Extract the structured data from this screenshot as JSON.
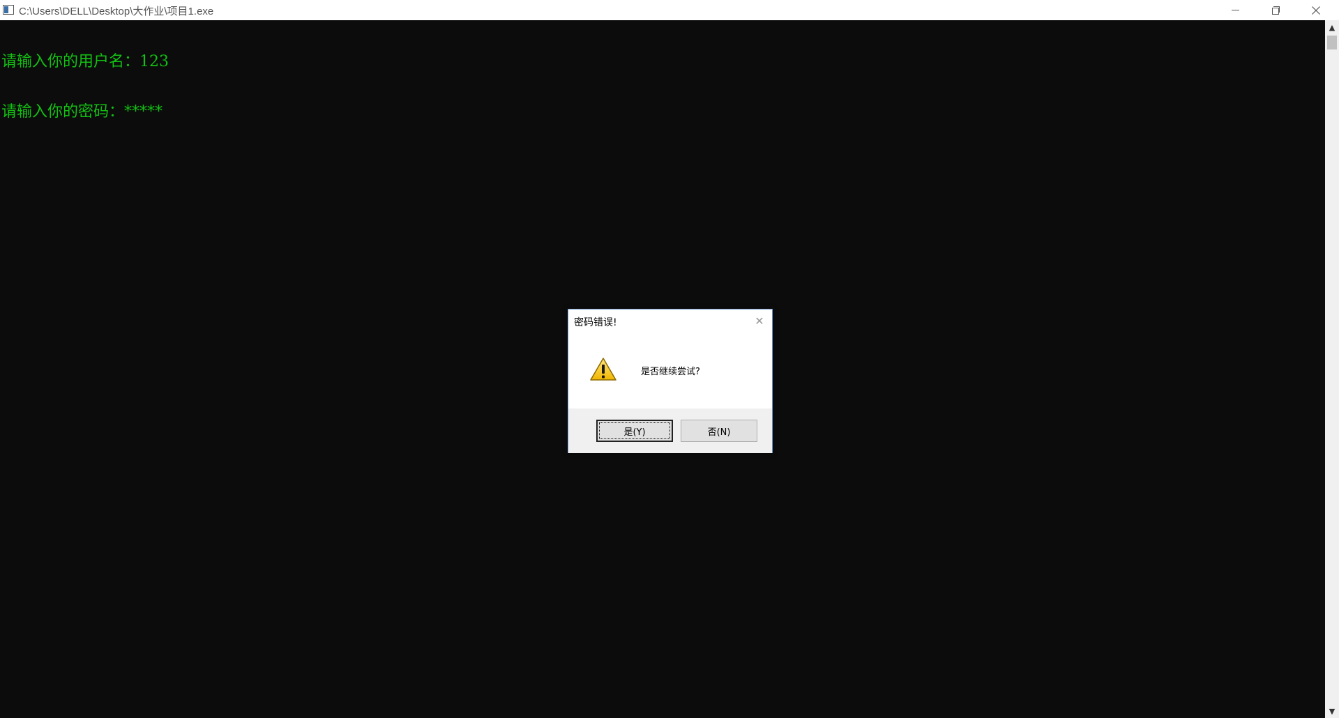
{
  "window": {
    "title": "C:\\Users\\DELL\\Desktop\\大作业\\项目1.exe",
    "minimize_icon": "minimize-icon",
    "maximize_icon": "restore-icon",
    "close_icon": "close-icon"
  },
  "console": {
    "line1": "请输入你的用户名：123",
    "line2": "请输入你的密码：*****",
    "text_color": "#13c013",
    "background": "#0c0c0c"
  },
  "dialog": {
    "title": "密码错误!",
    "message": "是否继续尝试?",
    "icon": "warning-icon",
    "yes_label": "是(Y)",
    "no_label": "否(N)",
    "close_glyph": "✕"
  },
  "scrollbar": {
    "up_glyph": "▲",
    "down_glyph": "▼"
  }
}
